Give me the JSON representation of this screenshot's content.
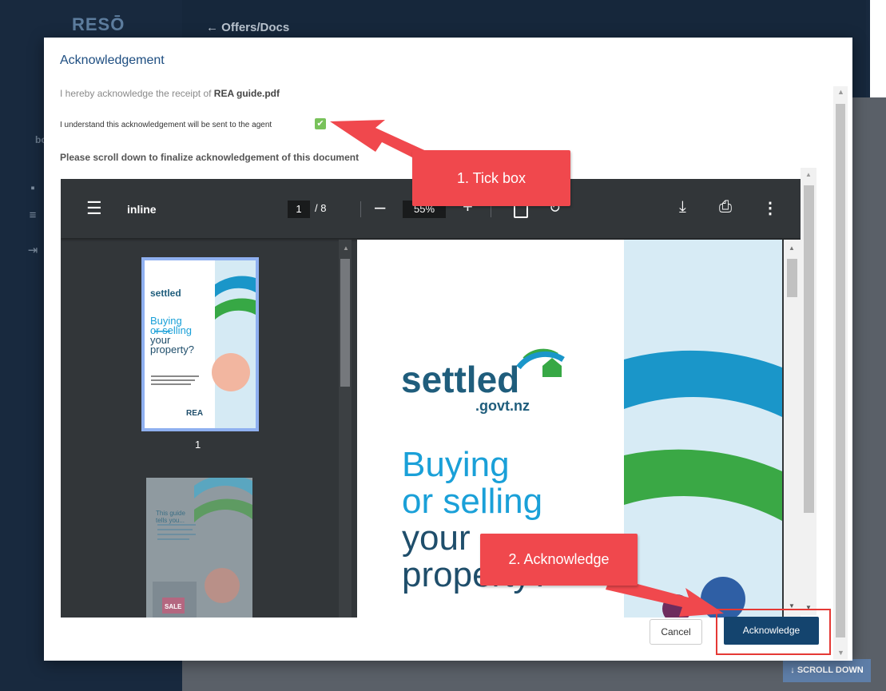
{
  "app": {
    "logo": "RESŌ",
    "back_nav": "← Offers/Docs",
    "side_label": "bo",
    "scroll_down": "↓ SCROLL DOWN"
  },
  "dialog": {
    "title": "Acknowledgement",
    "receipt_prefix": "I hereby acknowledge the receipt of ",
    "receipt_file": "REA guide.pdf",
    "understand": "I understand this acknowledgement will be sent to the agent",
    "checkbox_checked": true,
    "scroll_note": "Please scroll down to finalize acknowledgement of this document",
    "cancel_label": "Cancel",
    "ack_label": "Acknowledge"
  },
  "pdf": {
    "file_name": "inline",
    "current_page": "1",
    "total_pages": "/ 8",
    "zoom": "55%",
    "thumb1_number": "1",
    "page_logo": "settled",
    "page_logo_sub": ".govt.nz",
    "page_title_l1": "Buying",
    "page_title_l2": "or selling",
    "page_title_l3": "your",
    "page_title_l4": "property?",
    "thumb_title_l1": "Buying",
    "thumb_title_l2": "or selling",
    "thumb_title_l3": "your",
    "thumb_title_l4": "property?",
    "thumb_logo": "settled",
    "thumb_brand": "REA",
    "thumb2_text": "This guide tells you...",
    "thumb2_sign": "SALE"
  },
  "annotations": {
    "callout1": "1. Tick box",
    "callout2": "2. Acknowledge",
    "color": "#f0484d"
  },
  "colors": {
    "accent": "#14446e",
    "title": "#1d4d80",
    "checkbox": "#79c25b"
  }
}
